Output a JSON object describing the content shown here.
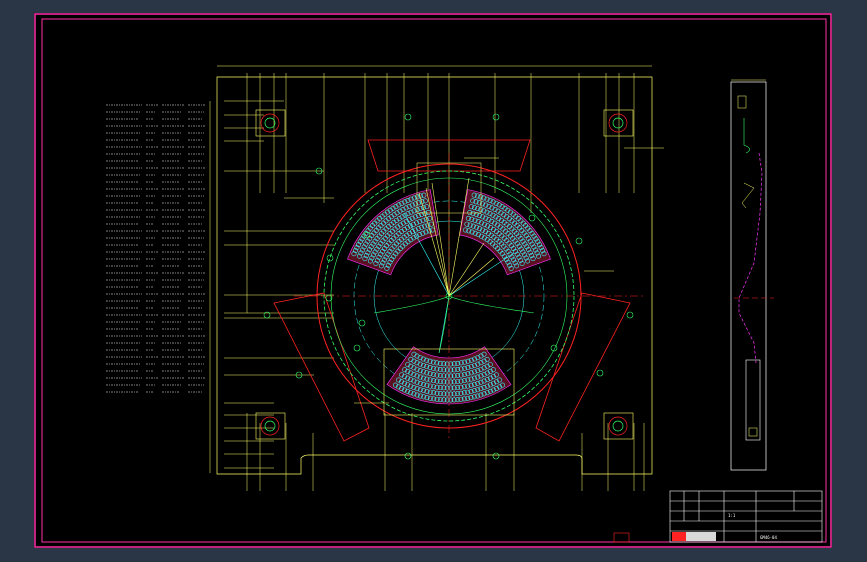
{
  "drawing": {
    "background_color": "#2a3645",
    "sheet_color": "#000000",
    "border_color": "#ff2fa8",
    "line_yellow": "#ffff66",
    "line_green": "#33ff66",
    "line_red": "#ff2222",
    "line_cyan": "#33ffff",
    "line_white": "#ffffff",
    "line_magenta": "#ff33ff"
  },
  "title_block": {
    "drawing_number": "GM46-04",
    "sheet_label": "1:1",
    "company_logo": "logo-icon"
  }
}
